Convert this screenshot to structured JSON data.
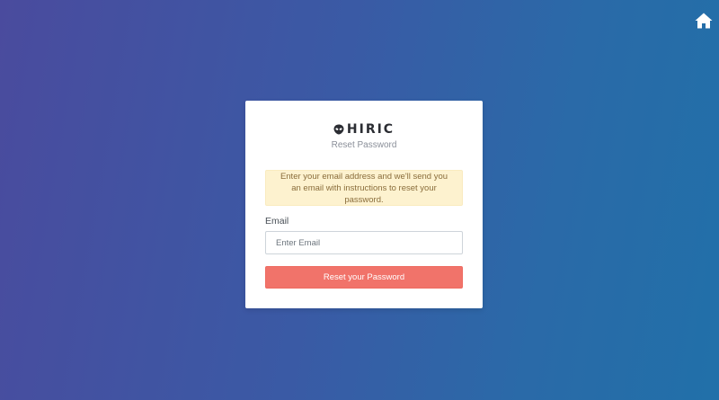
{
  "theme": {
    "background_gradient": [
      "#4a4b9e",
      "#2170a9"
    ],
    "button_color": "#f1736a",
    "alert_background": "#fdf2cf",
    "alert_text_color": "#8a6d3b"
  },
  "header": {
    "home_icon": "home-icon"
  },
  "brand": {
    "icon": "alien-head-icon",
    "name": "HIRIC"
  },
  "card": {
    "subtitle": "Reset Password",
    "alert_text": "Enter your email address and we'll send you an email with instructions to reset your password.",
    "email_label": "Email",
    "email_value": "",
    "email_placeholder": "Enter Email",
    "submit_label": "Reset your Password"
  }
}
